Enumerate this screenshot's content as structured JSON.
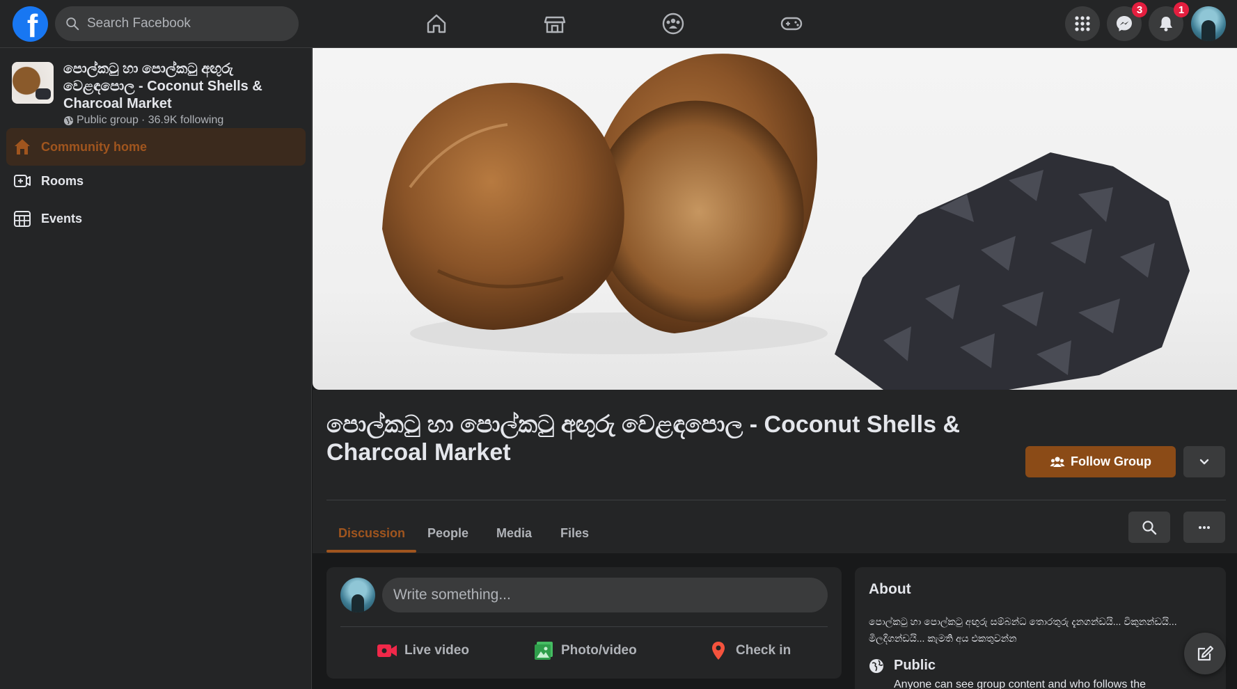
{
  "topbar": {
    "logo_letter": "f",
    "search_placeholder": "Search Facebook",
    "nav_icons": [
      "home-icon",
      "marketplace-icon",
      "groups-icon",
      "gaming-icon"
    ],
    "messenger_badge": "3",
    "notifications_badge": "1"
  },
  "sidebar": {
    "group_name": "පොල්කටු හා පොල්කටු අඟුරු වෙළඳපොල - Coconut Shells & Charcoal Market",
    "group_type": "Public group",
    "following": "· 36.9K following",
    "items": [
      {
        "label": "Community home",
        "icon": "home-icon",
        "active": true
      },
      {
        "label": "Rooms",
        "icon": "rooms-icon",
        "active": false
      },
      {
        "label": "Events",
        "icon": "calendar-icon",
        "active": false
      }
    ]
  },
  "main": {
    "title": "පොල්කටු හා පොල්කටු අඟුරු වෙළඳපොල - Coconut Shells & Charcoal Market",
    "follow_label": "Follow Group",
    "tabs": [
      {
        "label": "Discussion",
        "active": true
      },
      {
        "label": "People",
        "active": false
      },
      {
        "label": "Media",
        "active": false
      },
      {
        "label": "Files",
        "active": false
      }
    ]
  },
  "composer": {
    "placeholder": "Write something...",
    "actions": [
      {
        "label": "Live video",
        "icon": "live-video-icon",
        "color": "#f02849"
      },
      {
        "label": "Photo/video",
        "icon": "photo-icon",
        "color": "#45bd62"
      },
      {
        "label": "Check in",
        "icon": "location-pin-icon",
        "color": "#f5533d"
      }
    ]
  },
  "about": {
    "heading": "About",
    "description": "පොල්කටු හා පොල්කටු අඟුරු සම්බන්ධ තොරතුරු දැනගන්ඩයි... විකුනන්ඩයි... මිලදීගන්ඩයි... කැමති අය එකතුවන්න",
    "privacy": "Public",
    "privacy_desc": "Anyone can see group content and who follows the"
  },
  "colors": {
    "accent": "#a0551e",
    "follow_button": "#8b4b17",
    "badge": "#e41e3f",
    "facebook_blue": "#1877f2"
  }
}
